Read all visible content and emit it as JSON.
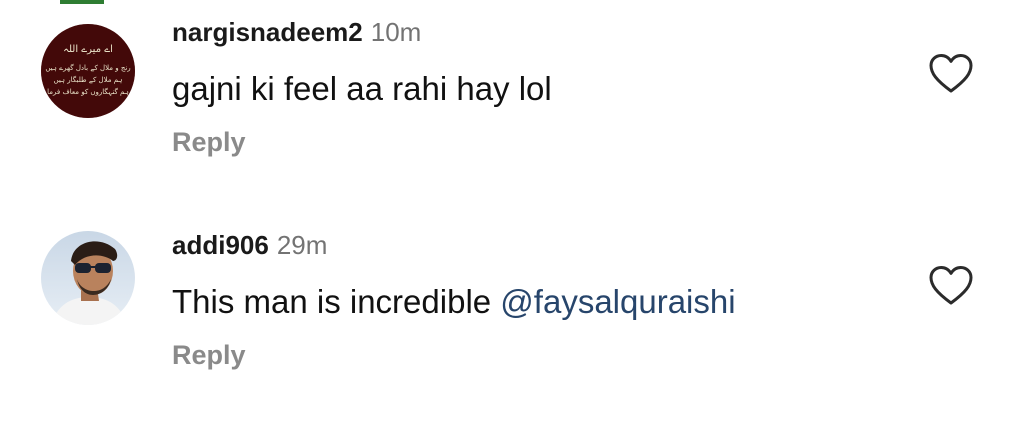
{
  "comments": [
    {
      "username": "nargisnadeem2",
      "time": "10m",
      "text": "gajni ki feel aa rahi hay lol",
      "mention": "",
      "reply_label": "Reply",
      "avatar_icon": "urdu-calligraphy-avatar",
      "avatar_text": {
        "line1": "اے میرے اللہ",
        "line2": "رنج و ملال کے بادل گھرے ہیں",
        "line3": "ہم ملال کے طلبگار ہیں",
        "line4": "ہم گنہگاروں کو معاف فرما"
      },
      "like_icon": "heart-outline-icon"
    },
    {
      "username": "addi906",
      "time": "29m",
      "text": "This man is incredible ",
      "mention": "@faysalquraishi",
      "reply_label": "Reply",
      "avatar_icon": "profile-photo-avatar",
      "like_icon": "heart-outline-icon"
    }
  ],
  "colors": {
    "text": "#111111",
    "muted": "#737373",
    "reply": "#8a8a8a",
    "mention": "#27456b",
    "avatar1_bg": "#4a0b0b"
  }
}
